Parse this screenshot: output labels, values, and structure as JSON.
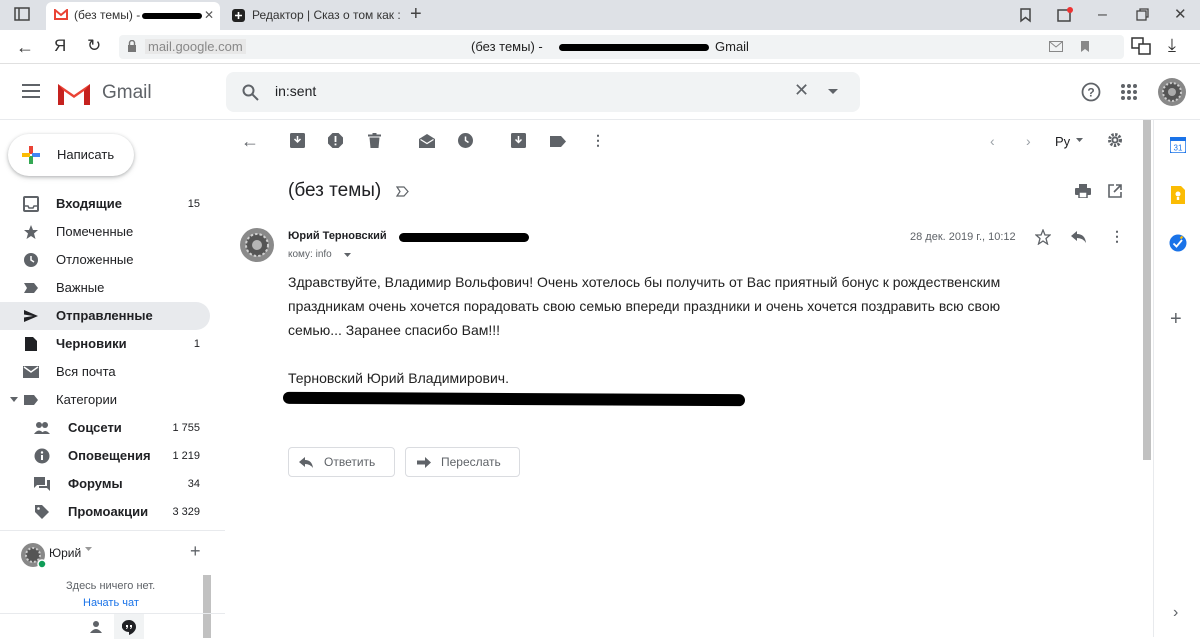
{
  "browser": {
    "tabs": [
      {
        "title": "(без темы) - "
      },
      {
        "title": "Редактор | Сказ о том как :"
      }
    ],
    "url": "mail.google.com",
    "page_title": "(без темы) -",
    "page_title_suffix": "Gmail"
  },
  "gmail": {
    "logo_text": "Gmail",
    "search_value": "in:sent"
  },
  "sidebar": {
    "compose_label": "Написать",
    "items": [
      {
        "label": "Входящие",
        "count": "15",
        "icon": "inbox-icon"
      },
      {
        "label": "Помеченные",
        "count": "",
        "icon": "star-icon"
      },
      {
        "label": "Отложенные",
        "count": "",
        "icon": "clock-icon"
      },
      {
        "label": "Важные",
        "count": "",
        "icon": "important-icon"
      },
      {
        "label": "Отправленные",
        "count": "",
        "icon": "send-icon"
      },
      {
        "label": "Черновики",
        "count": "1",
        "icon": "draft-icon"
      },
      {
        "label": "Вся почта",
        "count": "",
        "icon": "mail-icon"
      },
      {
        "label": "Категории",
        "count": "",
        "icon": "label-icon"
      }
    ],
    "categories": [
      {
        "label": "Соцсети",
        "count": "1 755",
        "icon": "people-icon"
      },
      {
        "label": "Оповещения",
        "count": "1 219",
        "icon": "info-icon"
      },
      {
        "label": "Форумы",
        "count": "34",
        "icon": "forum-icon"
      },
      {
        "label": "Промоакции",
        "count": "3 329",
        "icon": "tag-icon"
      }
    ]
  },
  "hangouts": {
    "user": "Юрий",
    "empty_text": "Здесь ничего нет.",
    "start_chat": "Начать чат"
  },
  "toolbar": {
    "lang": "Ру"
  },
  "message": {
    "subject": "(без темы)",
    "sender": "Юрий Терновский",
    "to_label": "кому: info",
    "date": "28 дек. 2019 г., 10:12",
    "body_p1": "Здравствуйте, Владимир Вольфович! Очень хотелось бы получить от Вас приятный бонус к рождественским праздникам очень хочется порадовать свою семью впереди праздники и очень хочется поздравить всю свою семью... Заранее спасибо Вам!!!",
    "signature": "Терновский Юрий Владимирович.",
    "reply_label": "Ответить",
    "forward_label": "Переслать"
  },
  "colors": {
    "gmail_red": "#ea4335",
    "selected_nav": "#e8eaed",
    "calendar": "#1a73e8",
    "keep": "#fbbc04",
    "tasks": "#1a73e8"
  }
}
